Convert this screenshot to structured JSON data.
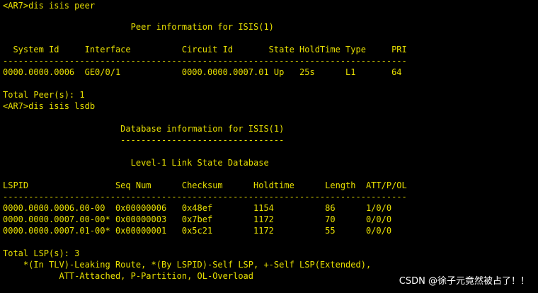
{
  "terminal": {
    "lines": [
      "<AR7>dis isis peer",
      "                         Peer information for ISIS(1)",
      "  System Id     Interface          Circuit Id       State HoldTime Type     PRI",
      "-------------------------------------------------------------------------------",
      "0000.0000.0006  GE0/0/1            0000.0000.0007.01 Up   25s      L1       64",
      "Total Peer(s): 1",
      "<AR7>dis isis lsdb",
      "                       Database information for ISIS(1)",
      "                       --------------------------------",
      "                         Level-1 Link State Database",
      "LSPID                 Seq Num      Checksum      Holdtime      Length  ATT/P/OL",
      "-------------------------------------------------------------------------------",
      "0000.0000.0006.00-00  0x00000006   0x48ef        1154          86      1/0/0",
      "0000.0000.0007.00-00* 0x00000003   0x7bef        1172          70      0/0/0",
      "0000.0000.0007.01-00* 0x00000001   0x5c21        1172          55      0/0/0",
      "Total LSP(s): 3",
      "    *(In TLV)-Leaking Route, *(By LSPID)-Self LSP, +-Self LSP(Extended),",
      "           ATT-Attached, P-Partition, OL-Overload"
    ]
  },
  "watermark": "CSDN @徐子元竟然被占了！！",
  "colors": {
    "background": "#000000",
    "text": "#e8e000",
    "watermark": "#ffffff"
  }
}
